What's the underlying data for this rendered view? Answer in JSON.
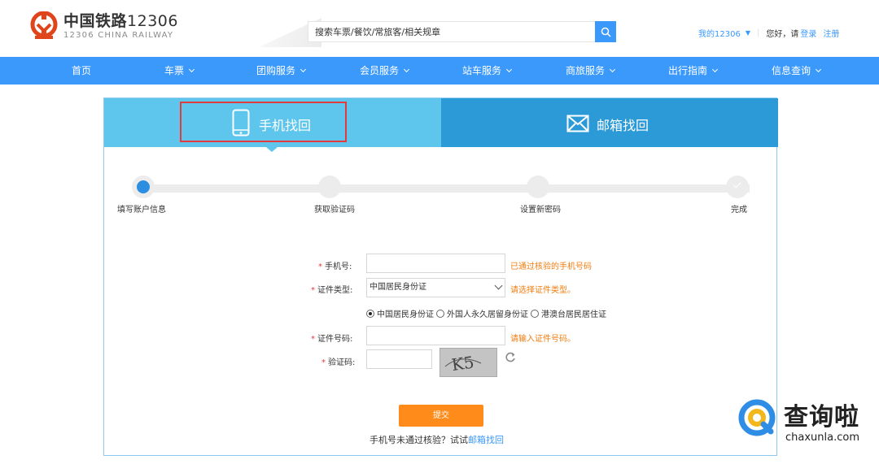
{
  "header": {
    "logo_cn": "中国铁路",
    "logo_num": "12306",
    "logo_en": "12306 CHINA RAILWAY",
    "search_placeholder": "搜索车票/餐饮/常旅客/相关规章",
    "my_account": "我的12306",
    "hello": "您好，请",
    "login": "登录",
    "register": "注册"
  },
  "nav": {
    "items": [
      {
        "label": "首页"
      },
      {
        "label": "车票"
      },
      {
        "label": "团购服务"
      },
      {
        "label": "会员服务"
      },
      {
        "label": "站车服务"
      },
      {
        "label": "商旅服务"
      },
      {
        "label": "出行指南"
      },
      {
        "label": "信息查询"
      }
    ]
  },
  "tabs": {
    "phone": "手机找回",
    "email": "邮箱找回"
  },
  "steps": [
    {
      "label": "填写账户信息",
      "state": "active"
    },
    {
      "label": "获取验证码",
      "state": "pending"
    },
    {
      "label": "设置新密码",
      "state": "pending"
    },
    {
      "label": "完成",
      "state": "done"
    }
  ],
  "form": {
    "phone_label": "手机号:",
    "phone_value": "",
    "phone_hint": "已通过核验的手机号码",
    "id_type_label": "证件类型:",
    "id_type_value": "中国居民身份证",
    "id_type_hint": "请选择证件类型。",
    "radio_options": [
      {
        "label": "中国居民身份证",
        "checked": true
      },
      {
        "label": "外国人永久居留身份证",
        "checked": false
      },
      {
        "label": "港澳台居民居住证",
        "checked": false
      }
    ],
    "id_number_label": "证件号码:",
    "id_number_value": "",
    "id_number_hint": "请输入证件号码。",
    "captcha_label": "验证码:",
    "captcha_value": "",
    "captcha_text": "K5",
    "submit": "提交",
    "foot_text": "手机号未通过核验？试试",
    "foot_link": "邮箱找回"
  },
  "watermark": {
    "cn": "查询啦",
    "en": "chaxunla.com"
  },
  "colors": {
    "brand_blue": "#3b99fc",
    "tab_light": "#5ec6ec",
    "tab_dark": "#2d9ad8",
    "logo_red": "#e0441b",
    "hint_orange": "#f07d10",
    "submit_orange": "#ff8c1a",
    "highlight_red": "#e23b3b"
  }
}
